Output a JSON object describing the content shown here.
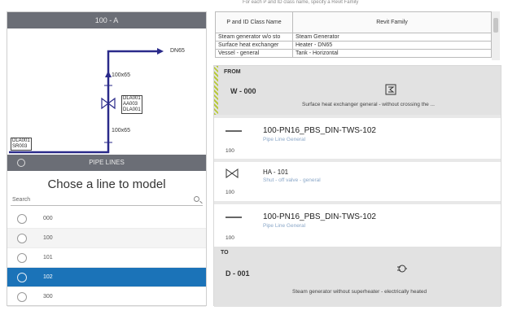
{
  "left_panel": {
    "header": "100 - A",
    "diagram": {
      "dn_label": "DN65",
      "pipe_label_top": "100x65",
      "pipe_label_bottom": "100x65",
      "valve_tags": [
        "DLA001",
        "AA003",
        "DLA001"
      ],
      "bottom_tags": [
        "DLA001",
        "SR003"
      ]
    },
    "pipe_lines_title": "PIPE LINES",
    "chose_title": "Chose a line to model",
    "search_placeholder": "Search",
    "lines": [
      {
        "label": "000",
        "selected": false
      },
      {
        "label": "100",
        "selected": false
      },
      {
        "label": "101",
        "selected": false
      },
      {
        "label": "102",
        "selected": true
      },
      {
        "label": "300",
        "selected": false
      }
    ]
  },
  "right_panel": {
    "hint": "For each P and ID class name, specify a Revit Family",
    "table": {
      "headers": [
        "P and ID Class Name",
        "Revit Family"
      ],
      "rows": [
        [
          "Steam generator w/o sto",
          "Steam Generator"
        ],
        [
          "Surface heat exchanger",
          "Heater - DN65"
        ],
        [
          "Vessel - general",
          "Tank - Horizontal"
        ]
      ]
    },
    "from": {
      "label": "FROM",
      "code": "W - 000",
      "icon": "heat-exchanger-icon",
      "description": "Surface heat exchanger general - without crossing the ..."
    },
    "segments": [
      {
        "glyph": "pipe-line-icon",
        "name": "100-PN16_PBS_DIN-TWS-102",
        "sub": "Pipe Line General",
        "size": "100"
      },
      {
        "glyph": "valve-icon",
        "name": "HA - 101",
        "sub": "Shut - off valve - general",
        "size": "100"
      },
      {
        "glyph": "pipe-line-icon",
        "name": "100-PN16_PBS_DIN-TWS-102",
        "sub": "Pipe Line General",
        "size": "100"
      }
    ],
    "to": {
      "label": "TO",
      "code": "D - 001",
      "icon": "steam-generator-icon",
      "description": "Steam generator without superheater - electrically heated"
    }
  }
}
